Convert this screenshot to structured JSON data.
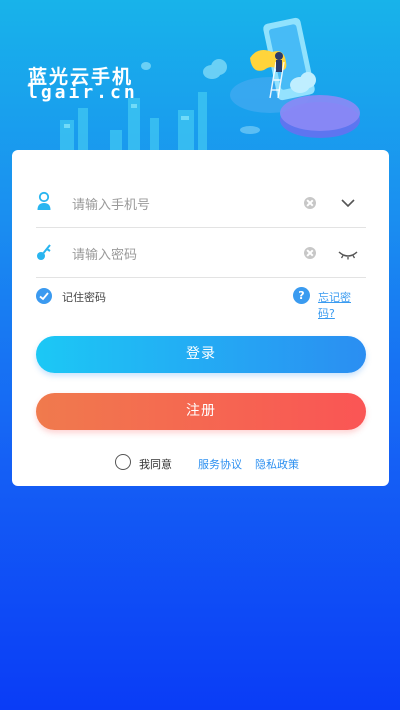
{
  "brand": {
    "name_cn": "蓝光云手机",
    "domain": "lgair.cn"
  },
  "login": {
    "phone_placeholder": "请输入手机号",
    "password_placeholder": "请输入密码",
    "remember_label": "记住密码",
    "help_glyph": "?",
    "forgot_label": "忘记密码?",
    "login_button": "登录",
    "register_button": "注册"
  },
  "agreement": {
    "agree_label": "我同意",
    "service_link": "服务协议",
    "privacy_link": "隐私政策"
  },
  "colors": {
    "background_top": "#18b3ea",
    "background_bottom": "#0a3cf6",
    "accent_blue": "#3a9bf0",
    "login_gradient_start": "#1cc8f5",
    "login_gradient_end": "#2b8ef2",
    "register_gradient_start": "#f07a4d",
    "register_gradient_end": "#fa5555"
  },
  "icons": {
    "phone_field": "user-icon",
    "password_field": "key-icon",
    "clear": "clear-icon",
    "account_dropdown": "chevron-down-icon",
    "password_visibility": "eye-closed-icon",
    "remember": "check-icon",
    "help": "question-icon"
  }
}
